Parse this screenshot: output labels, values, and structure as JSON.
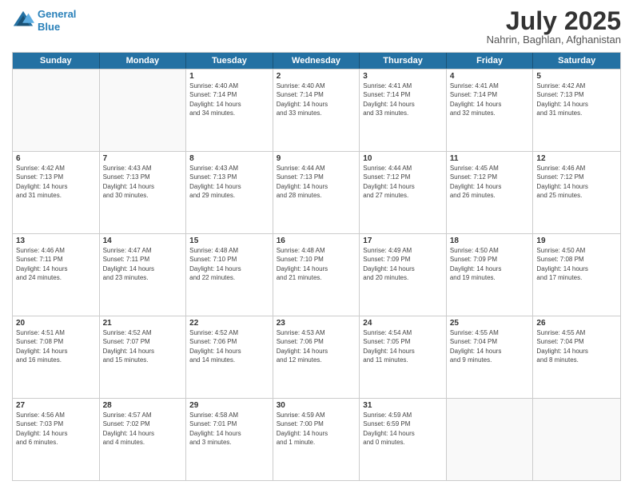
{
  "header": {
    "logo": {
      "line1": "General",
      "line2": "Blue"
    },
    "title": "July 2025",
    "subtitle": "Nahrin, Baghlan, Afghanistan"
  },
  "weekdays": [
    "Sunday",
    "Monday",
    "Tuesday",
    "Wednesday",
    "Thursday",
    "Friday",
    "Saturday"
  ],
  "weeks": [
    [
      {
        "day": null,
        "lines": []
      },
      {
        "day": null,
        "lines": []
      },
      {
        "day": "1",
        "lines": [
          "Sunrise: 4:40 AM",
          "Sunset: 7:14 PM",
          "Daylight: 14 hours",
          "and 34 minutes."
        ]
      },
      {
        "day": "2",
        "lines": [
          "Sunrise: 4:40 AM",
          "Sunset: 7:14 PM",
          "Daylight: 14 hours",
          "and 33 minutes."
        ]
      },
      {
        "day": "3",
        "lines": [
          "Sunrise: 4:41 AM",
          "Sunset: 7:14 PM",
          "Daylight: 14 hours",
          "and 33 minutes."
        ]
      },
      {
        "day": "4",
        "lines": [
          "Sunrise: 4:41 AM",
          "Sunset: 7:14 PM",
          "Daylight: 14 hours",
          "and 32 minutes."
        ]
      },
      {
        "day": "5",
        "lines": [
          "Sunrise: 4:42 AM",
          "Sunset: 7:13 PM",
          "Daylight: 14 hours",
          "and 31 minutes."
        ]
      }
    ],
    [
      {
        "day": "6",
        "lines": [
          "Sunrise: 4:42 AM",
          "Sunset: 7:13 PM",
          "Daylight: 14 hours",
          "and 31 minutes."
        ]
      },
      {
        "day": "7",
        "lines": [
          "Sunrise: 4:43 AM",
          "Sunset: 7:13 PM",
          "Daylight: 14 hours",
          "and 30 minutes."
        ]
      },
      {
        "day": "8",
        "lines": [
          "Sunrise: 4:43 AM",
          "Sunset: 7:13 PM",
          "Daylight: 14 hours",
          "and 29 minutes."
        ]
      },
      {
        "day": "9",
        "lines": [
          "Sunrise: 4:44 AM",
          "Sunset: 7:13 PM",
          "Daylight: 14 hours",
          "and 28 minutes."
        ]
      },
      {
        "day": "10",
        "lines": [
          "Sunrise: 4:44 AM",
          "Sunset: 7:12 PM",
          "Daylight: 14 hours",
          "and 27 minutes."
        ]
      },
      {
        "day": "11",
        "lines": [
          "Sunrise: 4:45 AM",
          "Sunset: 7:12 PM",
          "Daylight: 14 hours",
          "and 26 minutes."
        ]
      },
      {
        "day": "12",
        "lines": [
          "Sunrise: 4:46 AM",
          "Sunset: 7:12 PM",
          "Daylight: 14 hours",
          "and 25 minutes."
        ]
      }
    ],
    [
      {
        "day": "13",
        "lines": [
          "Sunrise: 4:46 AM",
          "Sunset: 7:11 PM",
          "Daylight: 14 hours",
          "and 24 minutes."
        ]
      },
      {
        "day": "14",
        "lines": [
          "Sunrise: 4:47 AM",
          "Sunset: 7:11 PM",
          "Daylight: 14 hours",
          "and 23 minutes."
        ]
      },
      {
        "day": "15",
        "lines": [
          "Sunrise: 4:48 AM",
          "Sunset: 7:10 PM",
          "Daylight: 14 hours",
          "and 22 minutes."
        ]
      },
      {
        "day": "16",
        "lines": [
          "Sunrise: 4:48 AM",
          "Sunset: 7:10 PM",
          "Daylight: 14 hours",
          "and 21 minutes."
        ]
      },
      {
        "day": "17",
        "lines": [
          "Sunrise: 4:49 AM",
          "Sunset: 7:09 PM",
          "Daylight: 14 hours",
          "and 20 minutes."
        ]
      },
      {
        "day": "18",
        "lines": [
          "Sunrise: 4:50 AM",
          "Sunset: 7:09 PM",
          "Daylight: 14 hours",
          "and 19 minutes."
        ]
      },
      {
        "day": "19",
        "lines": [
          "Sunrise: 4:50 AM",
          "Sunset: 7:08 PM",
          "Daylight: 14 hours",
          "and 17 minutes."
        ]
      }
    ],
    [
      {
        "day": "20",
        "lines": [
          "Sunrise: 4:51 AM",
          "Sunset: 7:08 PM",
          "Daylight: 14 hours",
          "and 16 minutes."
        ]
      },
      {
        "day": "21",
        "lines": [
          "Sunrise: 4:52 AM",
          "Sunset: 7:07 PM",
          "Daylight: 14 hours",
          "and 15 minutes."
        ]
      },
      {
        "day": "22",
        "lines": [
          "Sunrise: 4:52 AM",
          "Sunset: 7:06 PM",
          "Daylight: 14 hours",
          "and 14 minutes."
        ]
      },
      {
        "day": "23",
        "lines": [
          "Sunrise: 4:53 AM",
          "Sunset: 7:06 PM",
          "Daylight: 14 hours",
          "and 12 minutes."
        ]
      },
      {
        "day": "24",
        "lines": [
          "Sunrise: 4:54 AM",
          "Sunset: 7:05 PM",
          "Daylight: 14 hours",
          "and 11 minutes."
        ]
      },
      {
        "day": "25",
        "lines": [
          "Sunrise: 4:55 AM",
          "Sunset: 7:04 PM",
          "Daylight: 14 hours",
          "and 9 minutes."
        ]
      },
      {
        "day": "26",
        "lines": [
          "Sunrise: 4:55 AM",
          "Sunset: 7:04 PM",
          "Daylight: 14 hours",
          "and 8 minutes."
        ]
      }
    ],
    [
      {
        "day": "27",
        "lines": [
          "Sunrise: 4:56 AM",
          "Sunset: 7:03 PM",
          "Daylight: 14 hours",
          "and 6 minutes."
        ]
      },
      {
        "day": "28",
        "lines": [
          "Sunrise: 4:57 AM",
          "Sunset: 7:02 PM",
          "Daylight: 14 hours",
          "and 4 minutes."
        ]
      },
      {
        "day": "29",
        "lines": [
          "Sunrise: 4:58 AM",
          "Sunset: 7:01 PM",
          "Daylight: 14 hours",
          "and 3 minutes."
        ]
      },
      {
        "day": "30",
        "lines": [
          "Sunrise: 4:59 AM",
          "Sunset: 7:00 PM",
          "Daylight: 14 hours",
          "and 1 minute."
        ]
      },
      {
        "day": "31",
        "lines": [
          "Sunrise: 4:59 AM",
          "Sunset: 6:59 PM",
          "Daylight: 14 hours",
          "and 0 minutes."
        ]
      },
      {
        "day": null,
        "lines": []
      },
      {
        "day": null,
        "lines": []
      }
    ]
  ]
}
